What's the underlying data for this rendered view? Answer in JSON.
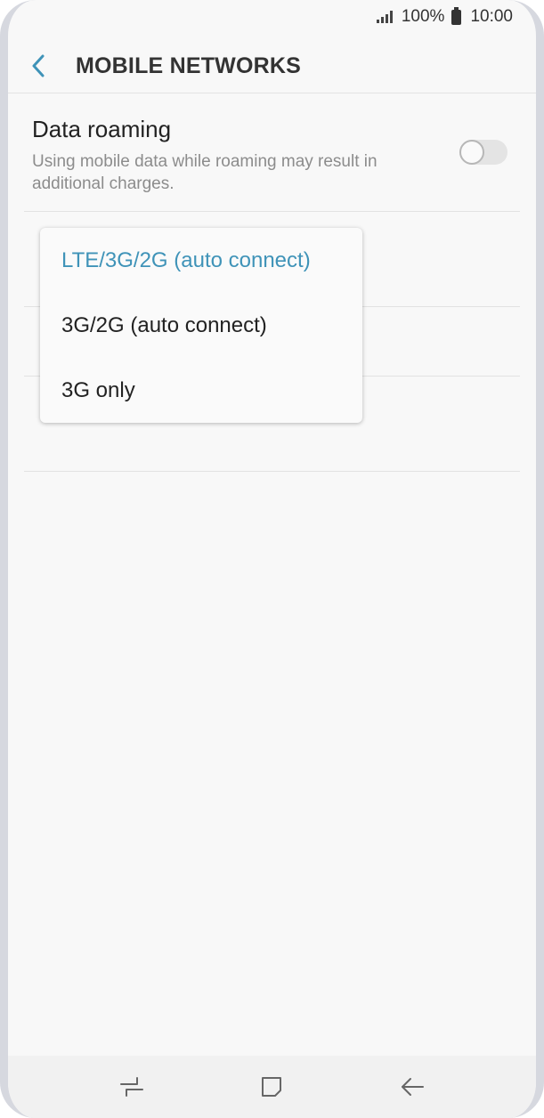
{
  "status_bar": {
    "battery": "100%",
    "time": "10:00"
  },
  "header": {
    "title": "MOBILE NETWORKS"
  },
  "settings": {
    "data_roaming": {
      "title": "Data roaming",
      "description": "Using mobile data while roaming may result in additional charges.",
      "enabled": false
    }
  },
  "network_mode_dropdown": {
    "options": [
      {
        "label": "LTE/3G/2G (auto connect)",
        "selected": true
      },
      {
        "label": "3G/2G (auto connect)",
        "selected": false
      },
      {
        "label": "3G only",
        "selected": false
      }
    ]
  },
  "colors": {
    "accent": "#3f93b8",
    "background": "#f8f8f8"
  },
  "icons": [
    "back-arrow-icon",
    "signal-icon",
    "battery-icon",
    "recent-apps-icon",
    "home-icon",
    "back-icon"
  ]
}
